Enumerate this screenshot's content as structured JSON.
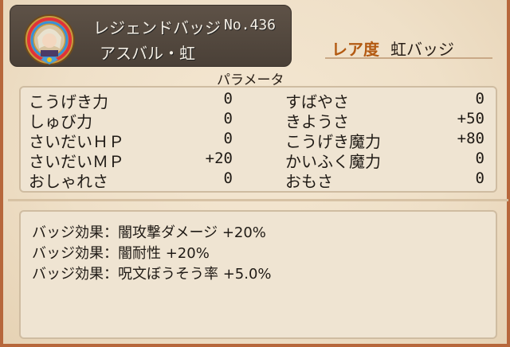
{
  "header": {
    "badge_type": "レジェンドバッジ",
    "number": "No.436",
    "name": "アスバル・虹"
  },
  "rarity": {
    "label": "レア度",
    "value": "虹バッジ"
  },
  "params": {
    "title": "パラメータ",
    "left": [
      {
        "name": "こうげき力",
        "value": "0"
      },
      {
        "name": "しゅび力",
        "value": "0"
      },
      {
        "name": "さいだいＨＰ",
        "value": "0"
      },
      {
        "name": "さいだいＭＰ",
        "value": "+20"
      },
      {
        "name": "おしゃれさ",
        "value": "0"
      }
    ],
    "right": [
      {
        "name": "すばやさ",
        "value": "0"
      },
      {
        "name": "きようさ",
        "value": "+50"
      },
      {
        "name": "こうげき魔力",
        "value": "+80"
      },
      {
        "name": "かいふく魔力",
        "value": "0"
      },
      {
        "name": "おもさ",
        "value": "0"
      }
    ]
  },
  "effects": [
    "バッジ効果：闇攻撃ダメージ +20%",
    "バッジ効果：闇耐性 +20%",
    "バッジ効果：呪文ぼうそう率 +5.0%"
  ],
  "colors": {
    "rarity_label": "#b35a12",
    "border": "#b7673b"
  }
}
